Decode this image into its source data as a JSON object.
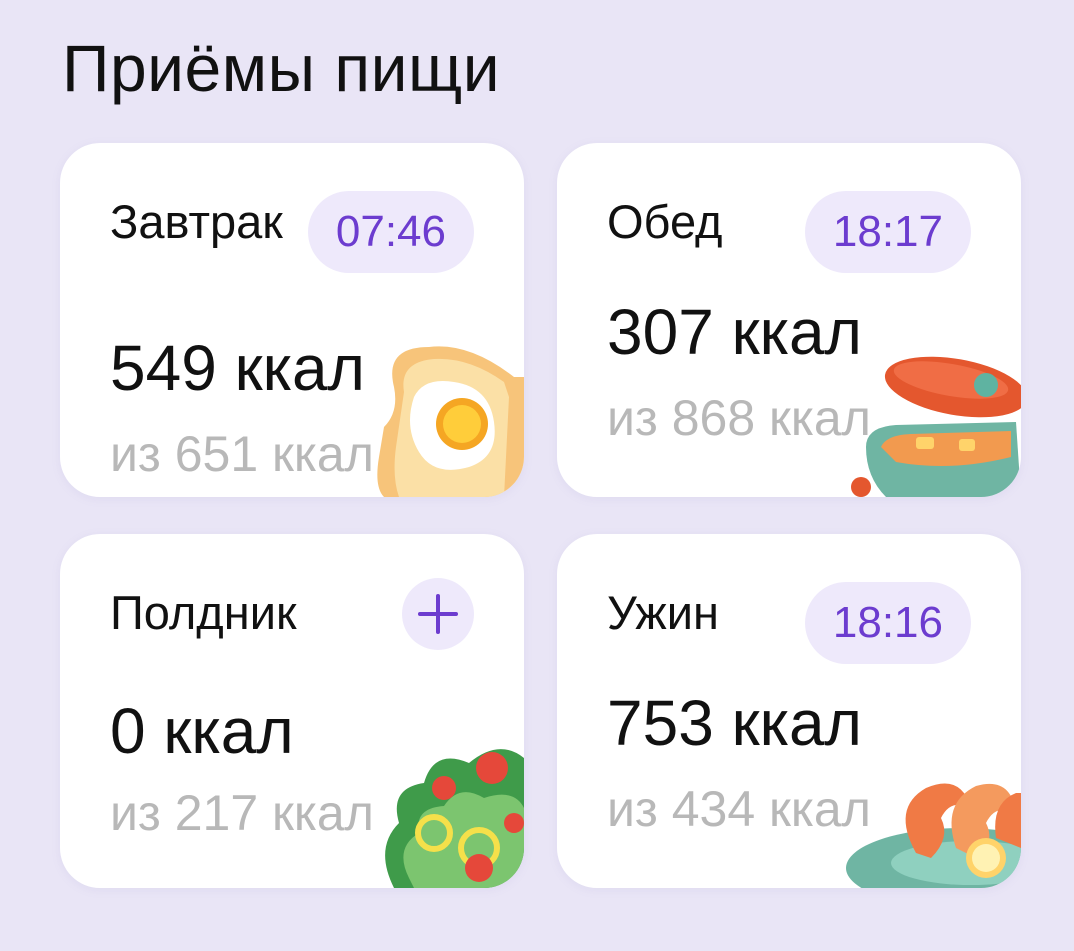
{
  "screen": {
    "title": "Приёмы пищи",
    "background_color": "#e9e5f6",
    "accent_color": "#6c3ccf"
  },
  "meals": [
    {
      "name": "Завтрак",
      "time": "07:46",
      "kcal": "549 ккал",
      "target": "из 651 ккал",
      "illustration_icon": "toast-egg-icon"
    },
    {
      "name": "Обед",
      "time": "18:17",
      "kcal": "307 ккал",
      "target": "из 868 ккал",
      "illustration_icon": "soup-bowl-icon"
    },
    {
      "name": "Полдник",
      "action": "+",
      "action_icon": "plus-icon",
      "kcal": "0 ккал",
      "target": "из 217 ккал",
      "illustration_icon": "salad-icon"
    },
    {
      "name": "Ужин",
      "time": "18:16",
      "kcal": "753 ккал",
      "target": "из 434 ккал",
      "illustration_icon": "shrimp-plate-icon"
    }
  ]
}
